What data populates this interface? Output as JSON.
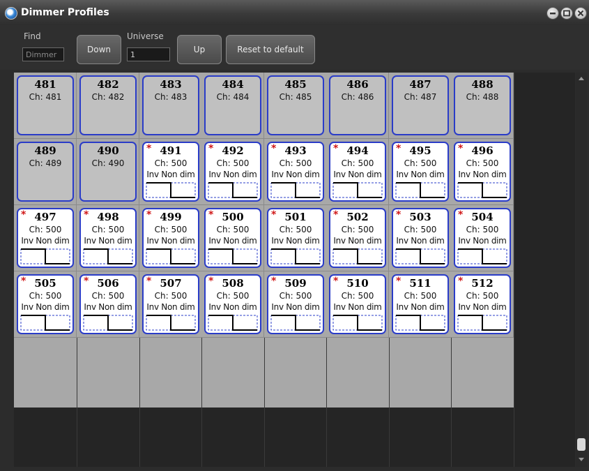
{
  "window": {
    "title": "Dimmer Profiles",
    "icon": "app-globe-icon"
  },
  "toolbar": {
    "find_label": "Find",
    "find_placeholder": "Dimmer",
    "down_label": "Down",
    "universe_label": "Universe",
    "universe_value": "1",
    "up_label": "Up",
    "reset_label": "Reset to default"
  },
  "channels": [
    {
      "num": "481",
      "ch": "Ch: 481",
      "profile": "",
      "star": ""
    },
    {
      "num": "482",
      "ch": "Ch: 482",
      "profile": "",
      "star": ""
    },
    {
      "num": "483",
      "ch": "Ch: 483",
      "profile": "",
      "star": ""
    },
    {
      "num": "484",
      "ch": "Ch: 484",
      "profile": "",
      "star": ""
    },
    {
      "num": "485",
      "ch": "Ch: 485",
      "profile": "",
      "star": ""
    },
    {
      "num": "486",
      "ch": "Ch: 486",
      "profile": "",
      "star": ""
    },
    {
      "num": "487",
      "ch": "Ch: 487",
      "profile": "",
      "star": ""
    },
    {
      "num": "488",
      "ch": "Ch: 488",
      "profile": "",
      "star": ""
    },
    {
      "num": "489",
      "ch": "Ch: 489",
      "profile": "",
      "star": ""
    },
    {
      "num": "490",
      "ch": "Ch: 490",
      "profile": "",
      "star": ""
    },
    {
      "num": "491",
      "ch": "Ch: 500",
      "profile": "Inv Non dim",
      "star": "*"
    },
    {
      "num": "492",
      "ch": "Ch: 500",
      "profile": "Inv Non dim",
      "star": "*"
    },
    {
      "num": "493",
      "ch": "Ch: 500",
      "profile": "Inv Non dim",
      "star": "*"
    },
    {
      "num": "494",
      "ch": "Ch: 500",
      "profile": "Inv Non dim",
      "star": "*"
    },
    {
      "num": "495",
      "ch": "Ch: 500",
      "profile": "Inv Non dim",
      "star": "*"
    },
    {
      "num": "496",
      "ch": "Ch: 500",
      "profile": "Inv Non dim",
      "star": "*"
    },
    {
      "num": "497",
      "ch": "Ch: 500",
      "profile": "Inv Non dim",
      "star": "*"
    },
    {
      "num": "498",
      "ch": "Ch: 500",
      "profile": "Inv Non dim",
      "star": "*"
    },
    {
      "num": "499",
      "ch": "Ch: 500",
      "profile": "Inv Non dim",
      "star": "*"
    },
    {
      "num": "500",
      "ch": "Ch: 500",
      "profile": "Inv Non dim",
      "star": "*"
    },
    {
      "num": "501",
      "ch": "Ch: 500",
      "profile": "Inv Non dim",
      "star": "*"
    },
    {
      "num": "502",
      "ch": "Ch: 500",
      "profile": "Inv Non dim",
      "star": "*"
    },
    {
      "num": "503",
      "ch": "Ch: 500",
      "profile": "Inv Non dim",
      "star": "*"
    },
    {
      "num": "504",
      "ch": "Ch: 500",
      "profile": "Inv Non dim",
      "star": "*"
    },
    {
      "num": "505",
      "ch": "Ch: 500",
      "profile": "Inv Non dim",
      "star": "*"
    },
    {
      "num": "506",
      "ch": "Ch: 500",
      "profile": "Inv Non dim",
      "star": "*"
    },
    {
      "num": "507",
      "ch": "Ch: 500",
      "profile": "Inv Non dim",
      "star": "*"
    },
    {
      "num": "508",
      "ch": "Ch: 500",
      "profile": "Inv Non dim",
      "star": "*"
    },
    {
      "num": "509",
      "ch": "Ch: 500",
      "profile": "Inv Non dim",
      "star": "*"
    },
    {
      "num": "510",
      "ch": "Ch: 500",
      "profile": "Inv Non dim",
      "star": "*"
    },
    {
      "num": "511",
      "ch": "Ch: 500",
      "profile": "Inv Non dim",
      "star": "*"
    },
    {
      "num": "512",
      "ch": "Ch: 500",
      "profile": "Inv Non dim",
      "star": "*"
    }
  ],
  "colors": {
    "tile_border": "#2a3cc8",
    "modified_star": "#d01818",
    "profile_curve": "#000000",
    "profile_dashed": "#2a3cc8"
  }
}
